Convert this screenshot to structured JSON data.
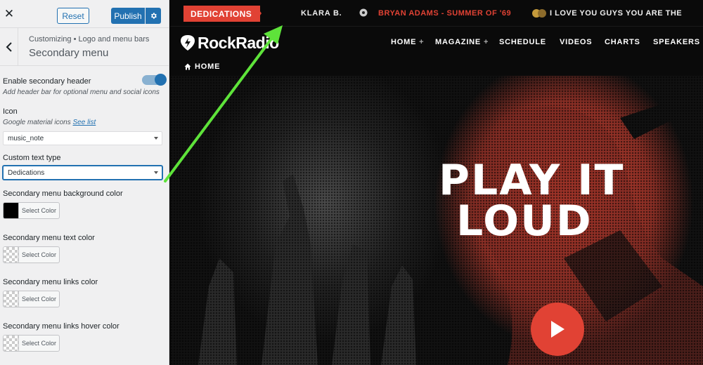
{
  "customizer": {
    "close_icon": "close-icon",
    "reset_label": "Reset",
    "publish_label": "Publish",
    "publish_gear_icon": "gear-icon",
    "breadcrumb": "Customizing • Logo and menu bars",
    "section_title": "Secondary menu",
    "controls": {
      "enable_label": "Enable secondary header",
      "enable_desc": "Add header bar for optional menu and social icons",
      "enable_on": true,
      "icon_label": "Icon",
      "icon_desc": "Google material icons",
      "icon_link": "See list",
      "icon_value": "music_note",
      "text_type_label": "Custom text type",
      "text_type_value": "Dedications",
      "bg_color_label": "Secondary menu background color",
      "bg_color_value": "#000000",
      "text_color_label": "Secondary menu text color",
      "links_color_label": "Secondary menu links color",
      "links_hover_label": "Secondary menu links hover color",
      "select_color_label": "Select Color"
    },
    "accent_color": "#2271b1"
  },
  "site": {
    "ticker": {
      "badge": "DEDICATIONS",
      "name": "KLARA B.",
      "song": "BRYAN ADAMS - SUMMER OF '69",
      "message": "I LOVE YOU GUYS YOU ARE THE"
    },
    "logo": "RockRadio",
    "nav": {
      "home": "HOME",
      "magazine": "MAGAZINE",
      "schedule": "SCHEDULE",
      "videos": "VIDEOS",
      "charts": "CHARTS",
      "speakers": "SPEAKERS",
      "plus": "+"
    },
    "breadcrumb_home": "HOME",
    "hero_line1": "PLAY IT",
    "hero_line2": "LOUD",
    "brand_red": "#e14234"
  }
}
